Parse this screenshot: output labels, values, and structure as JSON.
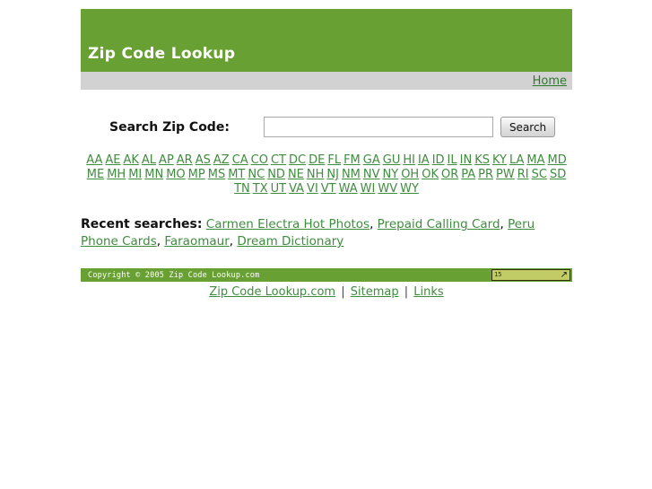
{
  "header": {
    "title": "Zip Code Lookup",
    "nav": {
      "home_label": "Home"
    },
    "bg_color": "#69a033",
    "navbar_color": "#d2d2d2"
  },
  "search": {
    "label": "Search Zip Code:",
    "value": "",
    "placeholder": "",
    "button_label": "Search"
  },
  "states": {
    "row1": [
      "AA",
      "AE",
      "AK",
      "AL",
      "AP",
      "AR",
      "AS",
      "AZ",
      "CA",
      "CO",
      "CT",
      "DC",
      "DE",
      "FL",
      "FM",
      "GA",
      "GU",
      "HI",
      "IA",
      "ID",
      "IL",
      "IN",
      "KS",
      "KY",
      "LA",
      "MA",
      "MD"
    ],
    "row2": [
      "ME",
      "MH",
      "MI",
      "MN",
      "MO",
      "MP",
      "MS",
      "MT",
      "NC",
      "ND",
      "NE",
      "NH",
      "NJ",
      "NM",
      "NV",
      "NY",
      "OH",
      "OK",
      "OR",
      "PA",
      "PR",
      "PW",
      "RI",
      "SC",
      "SD"
    ],
    "row3": [
      "TN",
      "TX",
      "UT",
      "VA",
      "VI",
      "VT",
      "WA",
      "WI",
      "WV",
      "WY"
    ]
  },
  "recent": {
    "label": "Recent searches:",
    "items": [
      "Carmen Electra Hot Photos",
      "Prepaid Calling Card",
      "Peru Phone Cards",
      "Faraomaur",
      "Dream Dictionary"
    ]
  },
  "footer": {
    "copyright": "Copyright © 2005 Zip Code Lookup.com",
    "badge": {
      "count": "15",
      "arrow": "↗"
    },
    "links": [
      "Zip Code Lookup.com",
      "Sitemap",
      "Links"
    ],
    "separator": "|"
  }
}
